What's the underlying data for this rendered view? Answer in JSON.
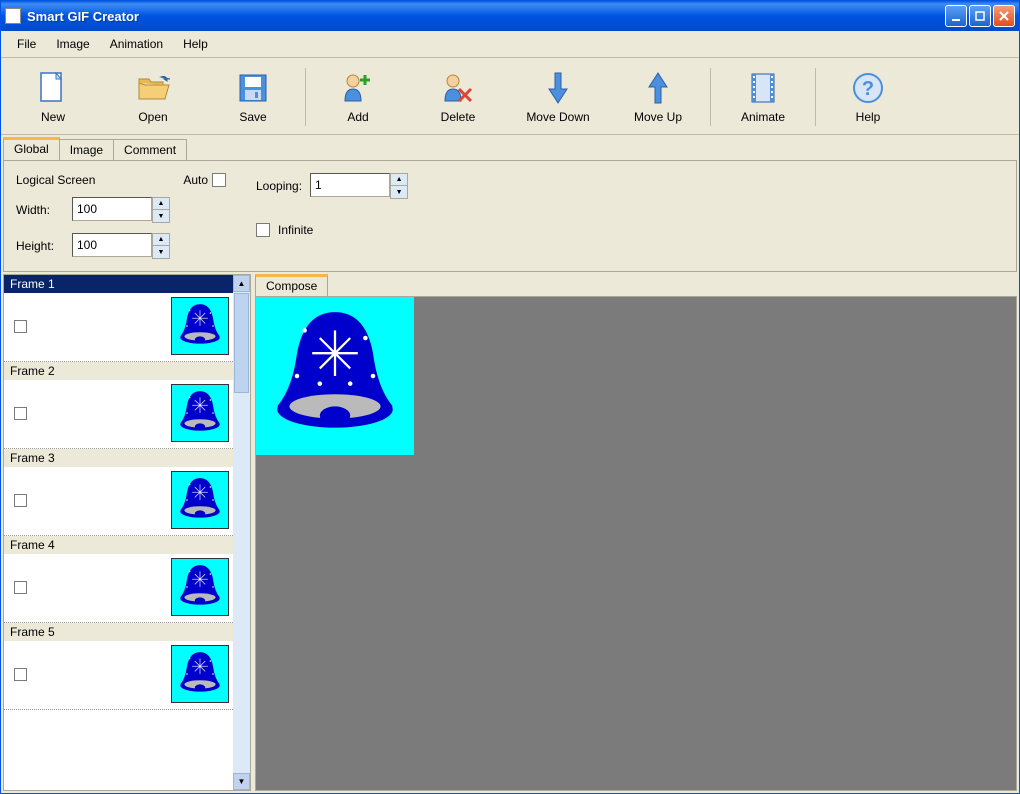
{
  "title": "Smart GIF Creator",
  "menubar": [
    "File",
    "Image",
    "Animation",
    "Help"
  ],
  "toolbar": [
    {
      "label": "New",
      "icon": "new"
    },
    {
      "label": "Open",
      "icon": "open"
    },
    {
      "label": "Save",
      "icon": "save"
    },
    {
      "sep": true
    },
    {
      "label": "Add",
      "icon": "add"
    },
    {
      "label": "Delete",
      "icon": "delete"
    },
    {
      "label": "Move Down",
      "icon": "down"
    },
    {
      "label": "Move Up",
      "icon": "up"
    },
    {
      "sep": true
    },
    {
      "label": "Animate",
      "icon": "animate"
    },
    {
      "sep": true
    },
    {
      "label": "Help",
      "icon": "help"
    }
  ],
  "tabs": {
    "global": "Global",
    "image": "Image",
    "comment": "Comment"
  },
  "global": {
    "logical_screen": "Logical Screen",
    "auto": "Auto",
    "width_label": "Width:",
    "width_value": "100",
    "height_label": "Height:",
    "height_value": "100",
    "looping_label": "Looping:",
    "looping_value": "1",
    "infinite": "Infinite"
  },
  "frames": [
    {
      "label": "Frame 1",
      "selected": true
    },
    {
      "label": "Frame 2",
      "selected": false
    },
    {
      "label": "Frame 3",
      "selected": false
    },
    {
      "label": "Frame 4",
      "selected": false
    },
    {
      "label": "Frame 5",
      "selected": false
    }
  ],
  "compose_tab": "Compose"
}
